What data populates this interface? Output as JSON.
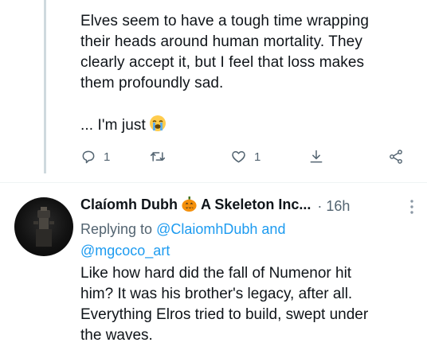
{
  "top_tweet": {
    "lines": [
      "Elves seem to have a tough time wrapping",
      "their heads around human mortality. They",
      "clearly accept it, but I feel that loss makes",
      "them profoundly sad."
    ],
    "last_line": "... I'm just",
    "emoji": "loudly-crying-face-emoji",
    "actions": {
      "reply_count": "1",
      "like_count": "1",
      "reply_icon": "reply-icon",
      "retweet_icon": "retweet-icon",
      "like_icon": "heart-icon",
      "save_icon": "save-icon",
      "share_icon": "share-icon"
    }
  },
  "reply_tweet": {
    "display_name_part1": "Claíomh Dubh",
    "display_name_part2": "A Skeleton Inc...",
    "name_emoji": "jack-o-lantern-emoji",
    "time": "· 16h",
    "replying_prefix": "Replying to",
    "replying_user1": "@ClaiomhDubh",
    "replying_and": "and",
    "replying_user2": "@mgcoco_art",
    "lines": [
      "Like how hard did the fall of Numenor hit",
      "him? It was his brother's legacy, after all.",
      "Everything Elros tried to build, swept under",
      "the waves."
    ]
  },
  "colors": {
    "text": "#0f1419",
    "secondary": "#536471",
    "link": "#1d9bf0",
    "thread_line": "#cfd9de"
  }
}
